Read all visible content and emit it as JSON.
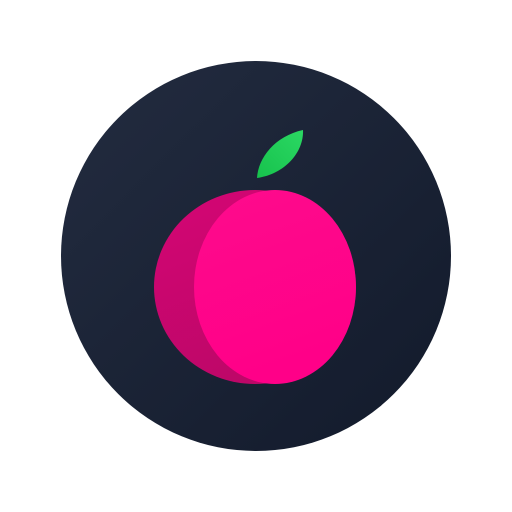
{
  "icon": {
    "name": "plum-app-icon",
    "colors": {
      "page_background": "#ffffff",
      "badge_gradient_start": "#232c40",
      "badge_gradient_end": "#121a2b",
      "fruit_light": "#fe0b8c",
      "fruit_bright": "#ff0088",
      "fruit_shadow": "#d40674",
      "fruit_shadow_dark": "#bd0768",
      "leaf_light": "#2bd863",
      "leaf_dark": "#17c24d"
    }
  }
}
